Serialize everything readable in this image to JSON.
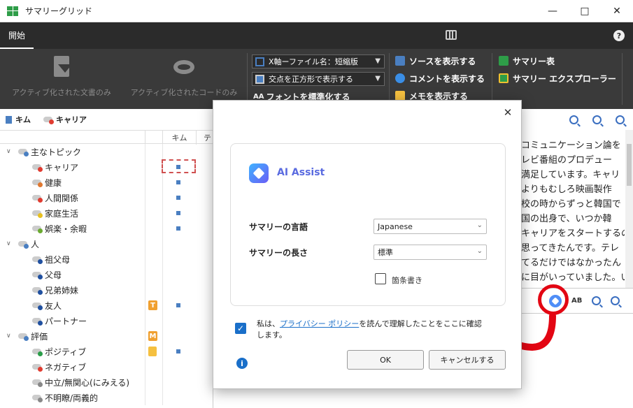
{
  "window": {
    "title": "サマリーグリッド"
  },
  "ribbon": {
    "tab_home": "開始",
    "btn_active_docs": "アクティブ化された文書のみ",
    "btn_active_codes": "アクティブ化されたコードのみ",
    "combo_xaxis": "X軸ーファイル名：短縮版",
    "combo_squares": "交点を正方形で表示する",
    "normalize_font": "フォントを標準化する",
    "normalize_font_prefix": "AA",
    "show_source": "ソースを表示する",
    "show_comment": "コメントを表示する",
    "show_memo": "メモを表示する",
    "summary_table": "サマリー表",
    "summary_explorer": "サマリー エクスプローラー"
  },
  "left": {
    "header_docs": "キム",
    "header_codes": "キャリア",
    "col_kim": "キム",
    "col_te": "テ",
    "tree": [
      {
        "label": "主なトピック",
        "level": 0,
        "expanded": true,
        "color": "#4a7fc1"
      },
      {
        "label": "キャリア",
        "level": 1,
        "color": "#e03c31",
        "cell": true
      },
      {
        "label": "健康",
        "level": 1,
        "color": "#e07830",
        "cell": true
      },
      {
        "label": "人間関係",
        "level": 1,
        "color": "#e03c31",
        "cell": true
      },
      {
        "label": "家庭生活",
        "level": 1,
        "color": "#e8c020",
        "cell": true
      },
      {
        "label": "娯楽・余暇",
        "level": 1,
        "color": "#6aaa30",
        "cell": true
      },
      {
        "label": "人",
        "level": 0,
        "expanded": true,
        "color": "#4a7fc1"
      },
      {
        "label": "祖父母",
        "level": 1,
        "color": "#2050a0"
      },
      {
        "label": "父母",
        "level": 1,
        "color": "#2050a0"
      },
      {
        "label": "兄弟姉妹",
        "level": 1,
        "color": "#2050a0"
      },
      {
        "label": "友人",
        "level": 1,
        "color": "#2050a0",
        "cell": true,
        "badge": "T"
      },
      {
        "label": "パートナー",
        "level": 1,
        "color": "#2050a0"
      },
      {
        "label": "評価",
        "level": 0,
        "expanded": true,
        "color": "#4a7fc1",
        "badge": "M"
      },
      {
        "label": "ポジティブ",
        "level": 1,
        "color": "#2a9d48",
        "cell": true,
        "memo": true
      },
      {
        "label": "ネガティブ",
        "level": 1,
        "color": "#e03c31"
      },
      {
        "label": "中立/無関心(にみえる)",
        "level": 1,
        "color": "#888888"
      },
      {
        "label": "不明瞭/両義的",
        "level": 1,
        "color": "#888888"
      }
    ]
  },
  "text_lines": [
    "コミュニケーション論を",
    "レビ番組のプロデュー",
    "満足しています。キャリ",
    "よりもむしろ映画製作",
    "校の時からずっと韓国で",
    "国の出身で、いつか韓",
    "キャリアをスタートするの",
    "思ってきたんです。テレ",
    "てるだけではなかったん",
    "に目がいっていました。い"
  ],
  "dialog": {
    "title": "AI Assist",
    "lang_label": "サマリーの言語",
    "lang_value": "Japanese",
    "length_label": "サマリーの長さ",
    "length_value": "標準",
    "bullets_label": "箇条書き",
    "privacy_pre": "私は、",
    "privacy_link": "プライバシー ポリシー",
    "privacy_post": "を読んで理解したことをここに確認します。",
    "ok": "OK",
    "cancel": "キャンセルする"
  },
  "toolbar": {
    "spell_label": "AB"
  },
  "colors": {
    "accent": "#1a6fc9",
    "highlight": "#e30613",
    "ai_gradient_start": "#3fb4ff",
    "ai_gradient_end": "#6a5cf6"
  }
}
